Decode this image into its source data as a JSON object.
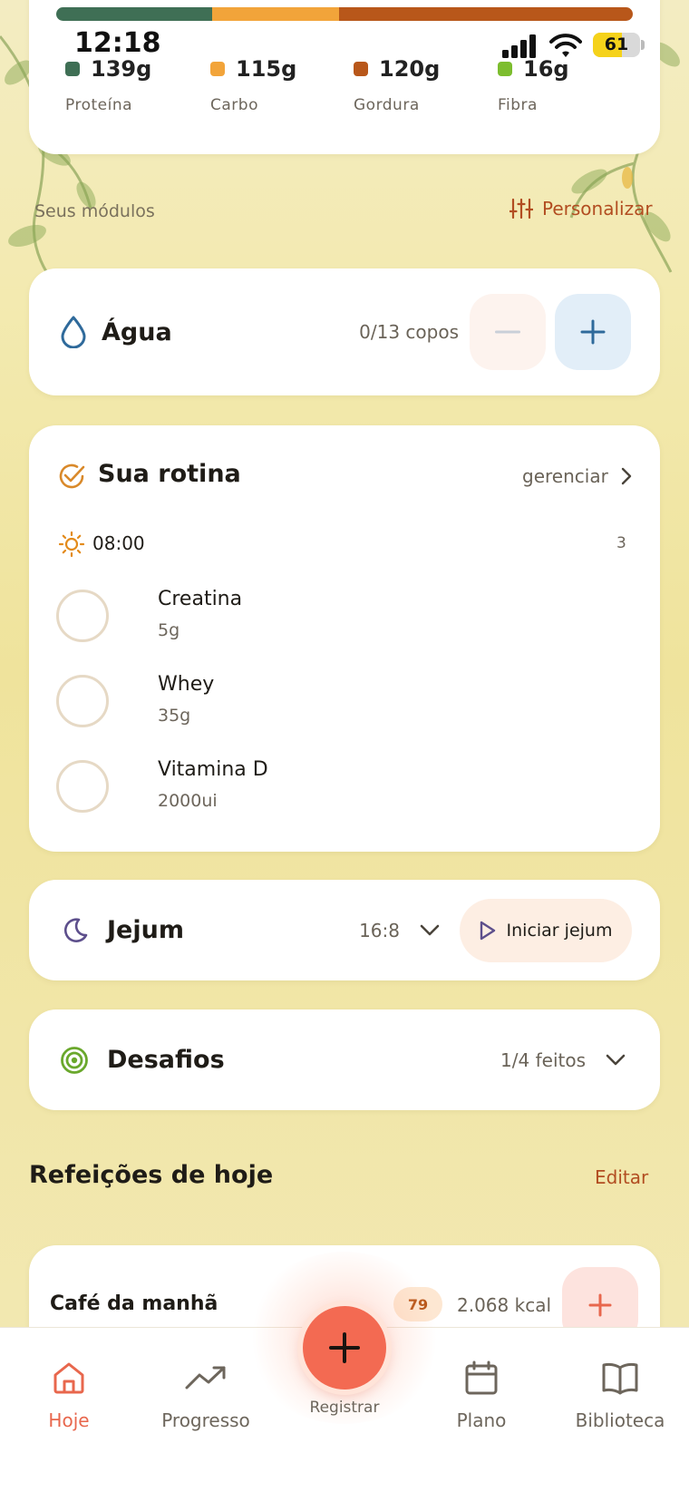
{
  "status_bar": {
    "time": "12:18",
    "battery": "61",
    "battery_level": 0.61
  },
  "macros": {
    "bar": [
      {
        "name": "Proteína",
        "fraction": 0.27,
        "color": "#3f6f55"
      },
      {
        "name": "Carbo",
        "fraction": 0.22,
        "color": "#f2a43a"
      },
      {
        "name": "Gordura",
        "fraction": 0.51,
        "color": "#b8571a"
      }
    ],
    "items": [
      {
        "value": "139g",
        "label": "Proteína",
        "color": "#3f6f55"
      },
      {
        "value": "115g",
        "label": "Carbo",
        "color": "#f2a43a"
      },
      {
        "value": "120g",
        "label": "Gordura",
        "color": "#b8571a"
      },
      {
        "value": "16g",
        "label": "Fibra",
        "color": "#7cbd2e"
      }
    ]
  },
  "modules": {
    "title": "Seus módulos",
    "customize": "Personalizar"
  },
  "water": {
    "title": "Água",
    "count": "0/13 copos"
  },
  "routine": {
    "title": "Sua rotina",
    "manage": "gerenciar",
    "time": "08:00",
    "count": "3",
    "items": [
      {
        "name": "Creatina",
        "dose": "5g"
      },
      {
        "name": "Whey",
        "dose": "35g"
      },
      {
        "name": "Vitamina D",
        "dose": "2000ui"
      }
    ]
  },
  "fasting": {
    "title": "Jejum",
    "protocol": "16:8",
    "start_label": "Iniciar jejum"
  },
  "challenges": {
    "title": "Desafios",
    "progress": "1/4 feitos"
  },
  "meals": {
    "title": "Refeições de hoje",
    "edit": "Editar",
    "first": {
      "name": "Café da manhã",
      "badge": "79",
      "kcal": "2.068 kcal"
    }
  },
  "nav": {
    "today": "Hoje",
    "progress": "Progresso",
    "register": "Registrar",
    "plan": "Plano",
    "library": "Biblioteca"
  },
  "colors": {
    "accent": "#e8674d",
    "brand_brown": "#b24d21",
    "water_blue": "#2f6a9b"
  }
}
